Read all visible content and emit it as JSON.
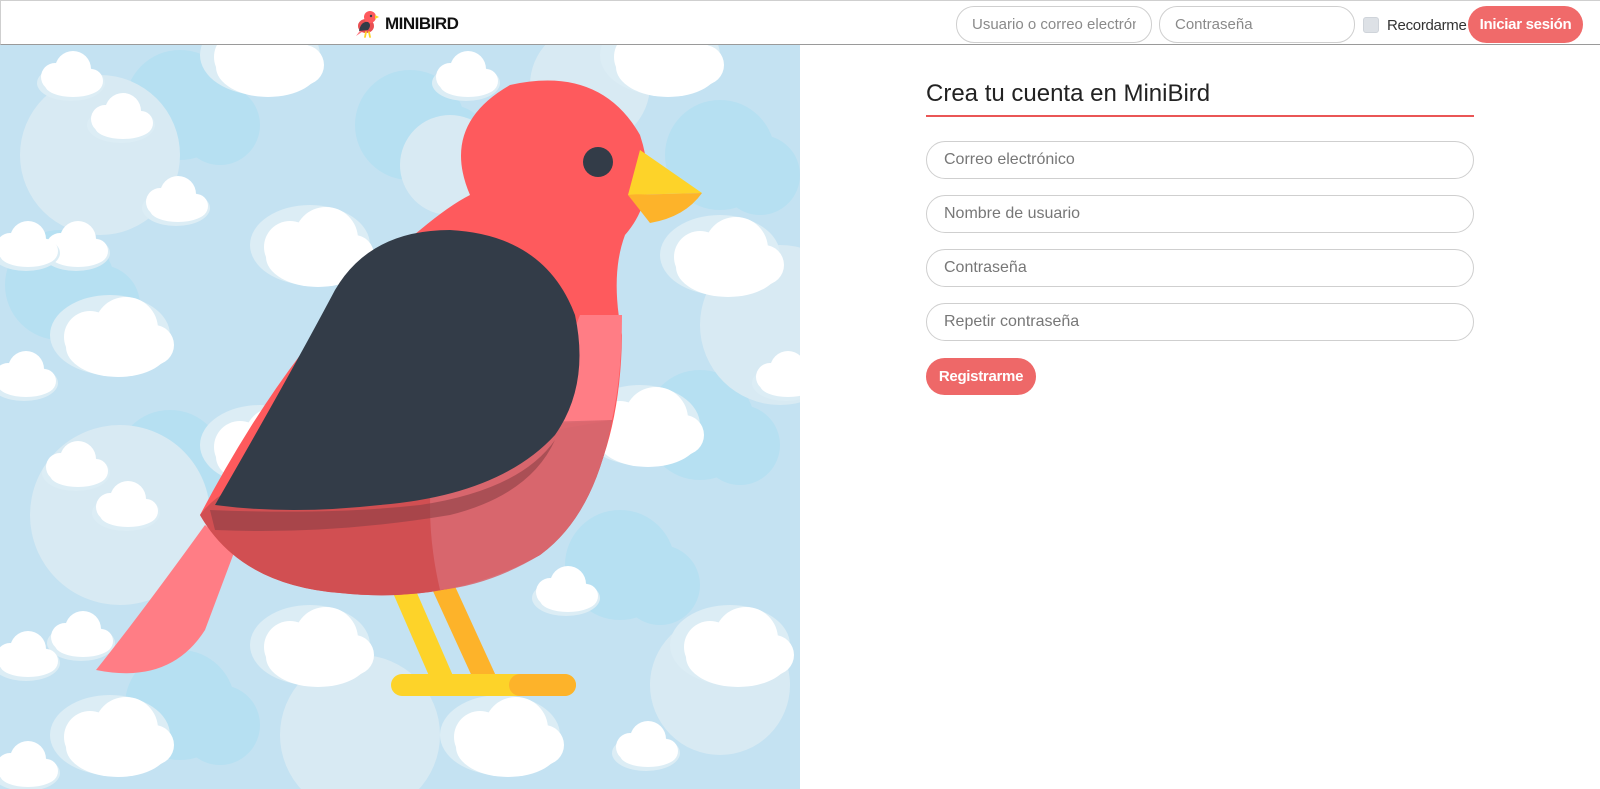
{
  "brand": {
    "name": "MINIBIRD"
  },
  "login": {
    "user_placeholder": "Usuario o correo electrónico",
    "password_placeholder": "Contraseña",
    "remember_label": "Recordarme",
    "submit_label": "Iniciar sesión"
  },
  "register": {
    "title": "Crea tu cuenta en MiniBird",
    "email_placeholder": "Correo electrónico",
    "username_placeholder": "Nombre de usuario",
    "password_placeholder": "Contraseña",
    "repeat_password_placeholder": "Repetir contraseña",
    "submit_label": "Registrarme"
  },
  "colors": {
    "accent": "#ee6868",
    "sky": "#c4e2f2",
    "bird_red": "#fe5a5d",
    "wing": "#333c48",
    "beak": "#fdd329"
  },
  "icons": {
    "logo": "bird-logo-icon",
    "hero": "bird-illustration"
  }
}
